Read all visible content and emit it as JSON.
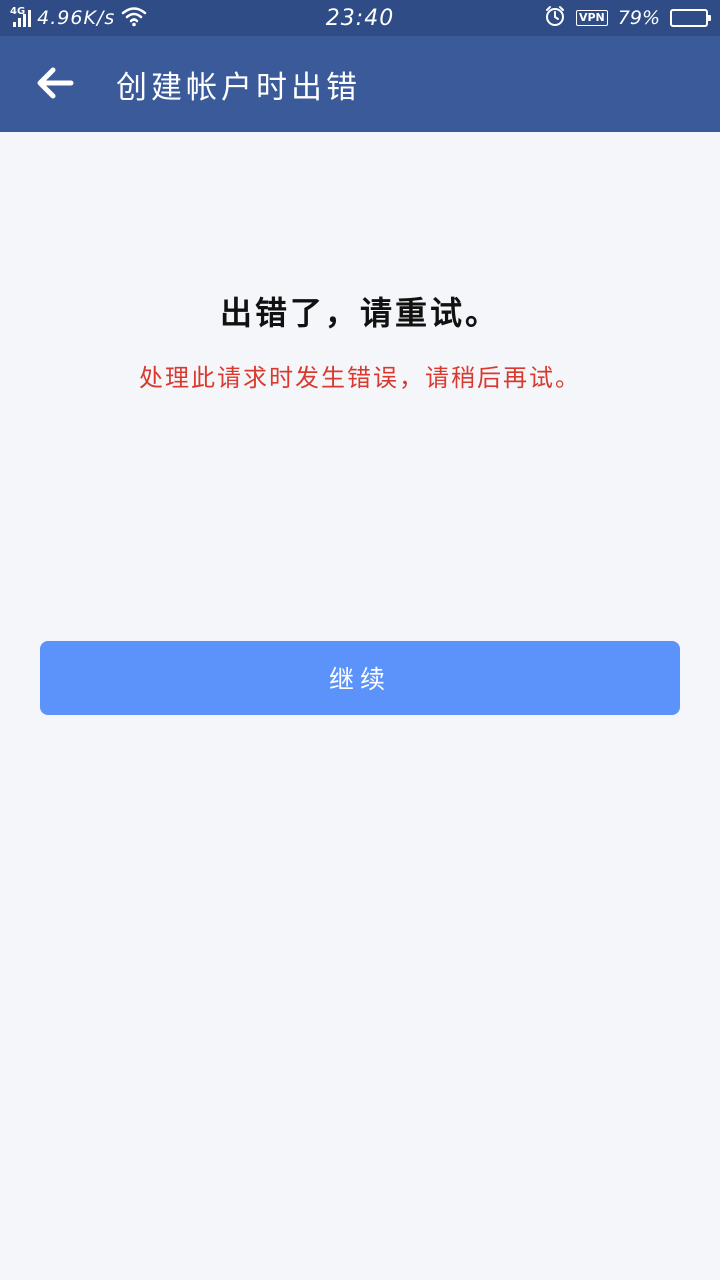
{
  "status_bar": {
    "network_type": "4G",
    "speed": "4.96K/s",
    "time": "23:40",
    "vpn_label": "VPN",
    "battery_percent": "79%",
    "battery_level": 0.79,
    "icons": [
      "signal-icon",
      "wifi-icon",
      "alarm-icon",
      "battery-icon"
    ]
  },
  "app_bar": {
    "title": "创建帐户时出错",
    "back_icon": "arrow-left-icon"
  },
  "error": {
    "title": "出错了，请重试。",
    "message": "处理此请求时发生错误，请稍后再试。"
  },
  "actions": {
    "continue_label": "继续"
  },
  "colors": {
    "status_bar": "#2f4c86",
    "app_bar": "#3b5a9a",
    "background": "#f4f6f9",
    "error_text": "#d93a30",
    "button": "#5b93fa"
  }
}
